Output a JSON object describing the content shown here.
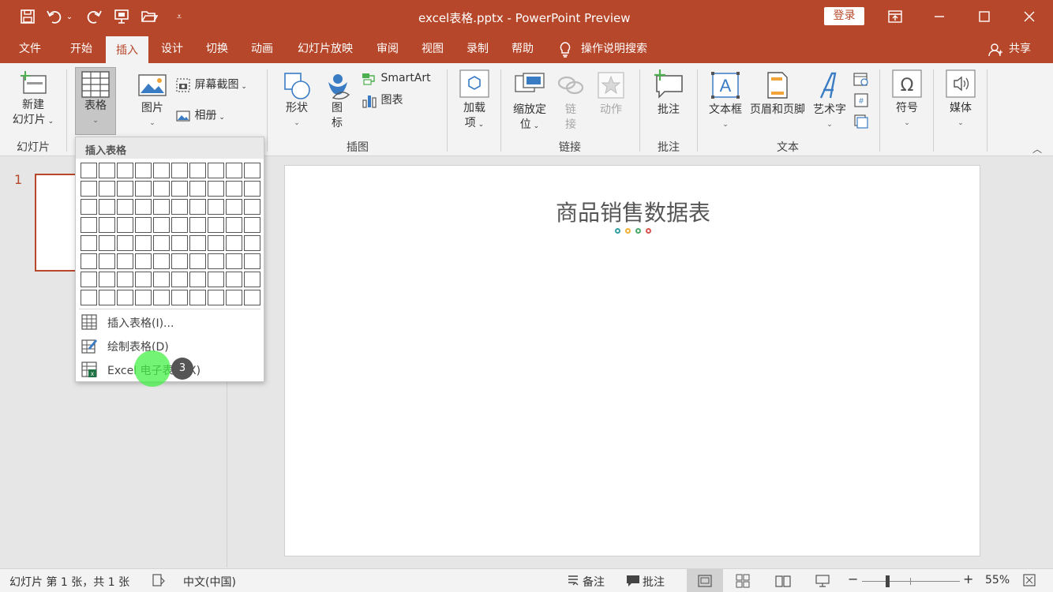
{
  "window": {
    "title": "excel表格.pptx  -  PowerPoint Preview",
    "login_label": "登录"
  },
  "tabs": [
    {
      "label": "文件"
    },
    {
      "label": "开始"
    },
    {
      "label": "插入"
    },
    {
      "label": "设计"
    },
    {
      "label": "切换"
    },
    {
      "label": "动画"
    },
    {
      "label": "幻灯片放映"
    },
    {
      "label": "审阅"
    },
    {
      "label": "视图"
    },
    {
      "label": "录制"
    },
    {
      "label": "帮助"
    },
    {
      "label": "操作说明搜索"
    }
  ],
  "share_label": "共享",
  "ribbon": {
    "new_slide": "新建\n幻灯片",
    "new_slide_l1": "新建",
    "new_slide_l2": "幻灯片",
    "table": "表格",
    "picture": "图片",
    "screenshot": "屏幕截图",
    "album": "相册",
    "shapes": "形状",
    "icons_l1": "图",
    "icons_l2": "标",
    "smartart": "SmartArt",
    "chart": "图表",
    "addins_l1": "加载",
    "addins_l2": "项",
    "zoom_l1": "缩放定",
    "zoom_l2": "位",
    "link_l1": "链",
    "link_l2": "接",
    "action": "动作",
    "comment": "批注",
    "textbox": "文本框",
    "header_footer": "页眉和页脚",
    "wordart": "艺术字",
    "symbol": "符号",
    "media": "媒体",
    "groups": {
      "slides": "幻灯片",
      "illustrations": "插图",
      "links": "链接",
      "comments": "批注",
      "text": "文本"
    }
  },
  "dropdown": {
    "header": "插入表格",
    "items": [
      {
        "label": "插入表格(I)..."
      },
      {
        "label": "绘制表格(D)"
      },
      {
        "label": "Excel 电子表格(X)"
      }
    ]
  },
  "slide_panel": {
    "slide_number": "1"
  },
  "slide": {
    "title": "商品销售数据表",
    "dot_colors": [
      "#2f9ea0",
      "#f2b035",
      "#4aa86b",
      "#d9534f"
    ]
  },
  "status": {
    "slide_info": "幻灯片 第 1 张，共 1 张",
    "language": "中文(中国)",
    "notes": "备注",
    "comments": "批注",
    "zoom": "55%"
  },
  "click_badge": "3",
  "colors": {
    "accent": "#b7472a"
  }
}
